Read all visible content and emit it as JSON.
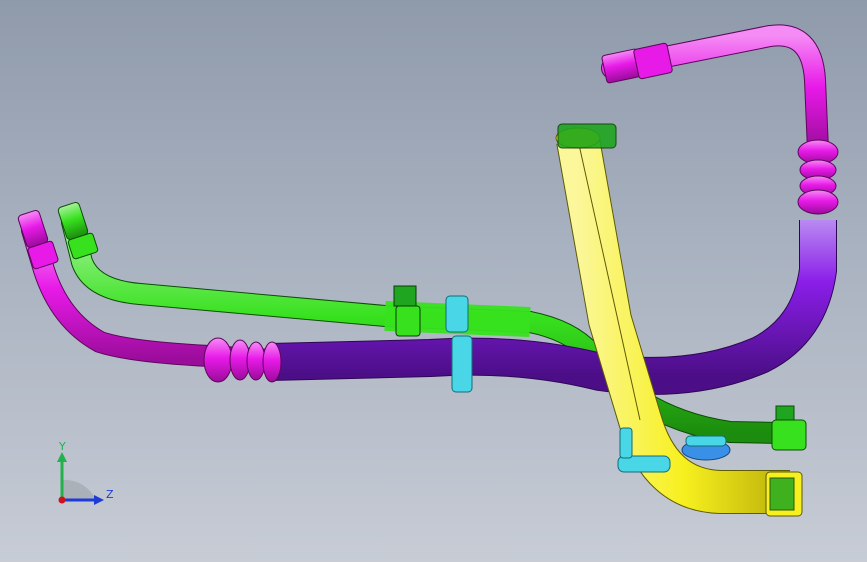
{
  "viewport": {
    "background_top": "#8f9aab",
    "background_bottom": "#c7ccd5"
  },
  "axis_triad": {
    "y_label": "Y",
    "z_label": "Z",
    "y_color": "#22b14c",
    "z_color": "#1f3bd6",
    "origin_color": "#d0101a"
  },
  "model": {
    "tube_colors": {
      "magenta": "#e81ae8",
      "green": "#37e11e",
      "purple": "#8a1ee8",
      "yellow": "#f7f01e"
    },
    "clip_colors": {
      "green_clip": "#1fa51f",
      "cyan_clip": "#49d6e6",
      "blue_clip": "#3a8fe6"
    }
  }
}
